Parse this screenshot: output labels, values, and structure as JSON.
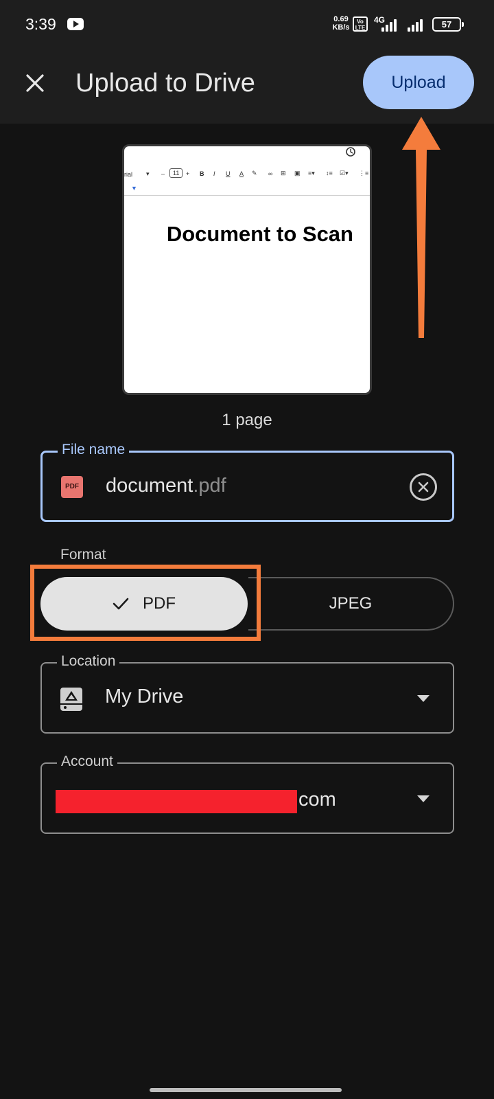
{
  "status_bar": {
    "time": "3:39",
    "net_speed_value": "0.69",
    "net_speed_unit": "KB/s",
    "volte_top": "Vo",
    "volte_bottom": "LTE",
    "network_type": "4G",
    "battery": "57"
  },
  "app_bar": {
    "title": "Upload to Drive",
    "upload_label": "Upload"
  },
  "preview": {
    "heading": "Document to Scan",
    "toolbar_font": "rial",
    "toolbar_size": "11",
    "page_count": "1 page"
  },
  "file_name": {
    "label": "File name",
    "base": "document",
    "extension": ".pdf",
    "badge": "PDF"
  },
  "format": {
    "label": "Format",
    "options": [
      "PDF",
      "JPEG"
    ],
    "selected": "PDF"
  },
  "location": {
    "label": "Location",
    "value": "My Drive"
  },
  "account": {
    "label": "Account",
    "suffix": "com"
  },
  "colors": {
    "background": "#131313",
    "bar": "#1e1e1e",
    "accent": "#a8c7fa",
    "annotation": "#f47c3c",
    "redaction": "#f5222d"
  }
}
